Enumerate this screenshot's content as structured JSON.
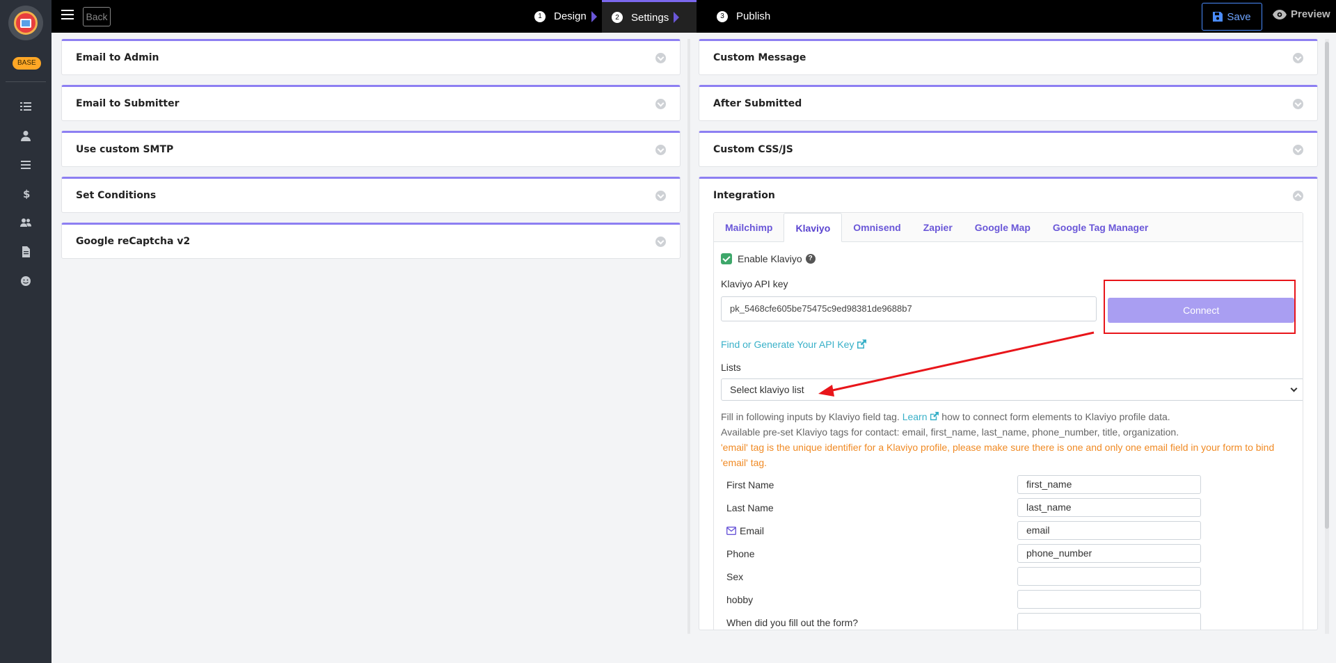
{
  "app": {
    "badge": "BASE"
  },
  "topbar": {
    "back_label": "Back",
    "steps": [
      {
        "num": "1",
        "label": "Design"
      },
      {
        "num": "2",
        "label": "Settings"
      },
      {
        "num": "3",
        "label": "Publish"
      }
    ],
    "save_label": "Save",
    "preview_label": "Preview"
  },
  "sidebar": {
    "icons": [
      "list-icon",
      "user-icon",
      "menu-icon",
      "dollar-icon",
      "users-icon",
      "document-icon",
      "smile-icon"
    ]
  },
  "left_panels": [
    {
      "title": "Email to Admin"
    },
    {
      "title": "Email to Submitter"
    },
    {
      "title": "Use custom SMTP"
    },
    {
      "title": "Set Conditions"
    },
    {
      "title": "Google reCaptcha v2"
    }
  ],
  "right_panels": [
    {
      "title": "Custom Message"
    },
    {
      "title": "After Submitted"
    },
    {
      "title": "Custom CSS/JS"
    },
    {
      "title": "Integration"
    }
  ],
  "integration": {
    "tabs": [
      "Mailchimp",
      "Klaviyo",
      "Omnisend",
      "Zapier",
      "Google Map",
      "Google Tag Manager"
    ],
    "active_tab": "Klaviyo",
    "enable_label": "Enable Klaviyo",
    "api_key_label": "Klaviyo API key",
    "api_key_value": "pk_5468cfe605be75475c9ed98381de9688b7",
    "connect_label": "Connect",
    "find_link": "Find or Generate Your API Key",
    "lists_label": "Lists",
    "lists_select": "Select klaviyo list",
    "info_line1_pre": "Fill in following inputs by Klaviyo field tag.",
    "info_line1_link": "Learn",
    "info_line1_post": "how to connect form elements to Klaviyo profile data.",
    "info_line2": "Available pre-set Klaviyo tags for contact: email, first_name, last_name, phone_number, title, organization.",
    "warn_text": "'email' tag is the unique identifier for a Klaviyo profile, please make sure there is one and only one email field in your form to bind 'email' tag.",
    "fields": [
      {
        "label": "First Name",
        "value": "first_name"
      },
      {
        "label": "Last Name",
        "value": "last_name"
      },
      {
        "label": "Email",
        "value": "email"
      },
      {
        "label": "Phone",
        "value": "phone_number"
      },
      {
        "label": "Sex",
        "value": ""
      },
      {
        "label": "hobby",
        "value": ""
      },
      {
        "label": "When did you fill out the form?",
        "value": ""
      }
    ]
  },
  "colors": {
    "accent": "#8d7ff2",
    "connect_bg": "#a99ef2",
    "highlight": "#e8151a",
    "warning": "#f08a24",
    "link": "#38b0c8"
  }
}
